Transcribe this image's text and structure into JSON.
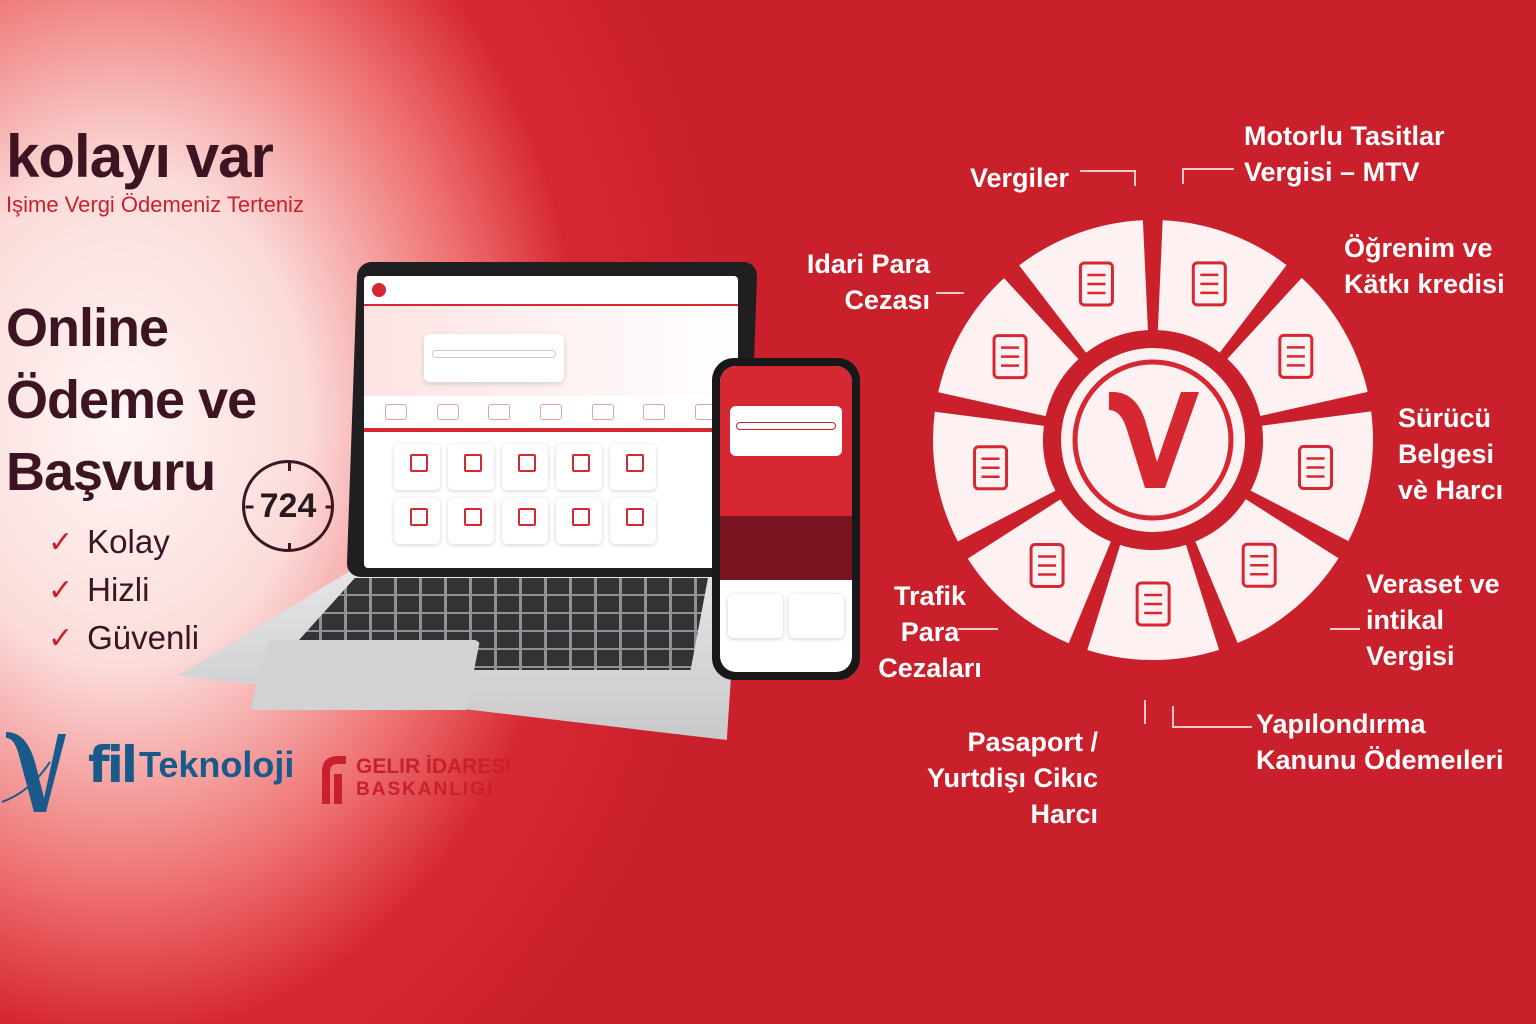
{
  "hero": {
    "brand": "kolayı var",
    "tagline": "Işime Vergi Ödemeniz Terteniz",
    "headline_lines": [
      "Online",
      "Ödeme ve",
      "Başvuru"
    ],
    "badge": "724",
    "checks": [
      "Kolay",
      "Hizli",
      "Güvenli"
    ],
    "check_symbol": "✓"
  },
  "logos": {
    "fil_mark": "fil",
    "fil_text": "Teknoloji",
    "gib_line1": "GELIR İDARESI",
    "gib_line2": "BASKANLIGI"
  },
  "wheel": {
    "center_icon": "v-logo-icon",
    "segments": [
      {
        "label": "Vergiler",
        "icon": "gavel-icon"
      },
      {
        "label": "Motorlu Tasitlar Vergisi – MTV",
        "icon": "graduate-icon"
      },
      {
        "label": "Öğrenim ve Katkı kredisi",
        "icon": "document-icon"
      },
      {
        "label": "Sürücü Belgesi vè Harcı",
        "icon": "form-pen-icon"
      },
      {
        "label": "Veraset ve intikal Vergisi",
        "icon": "document-seal-icon"
      },
      {
        "label": "Yapılondırma Kanunu Ödemeıleri",
        "icon": "star-card-icon"
      },
      {
        "label": "Pasaport / Yurtdişı Cikıc Harcı",
        "icon": "passport-icon"
      },
      {
        "label": "Trafik Para Cezaları",
        "icon": "car-document-icon"
      },
      {
        "label": "Idari Para Cezası",
        "icon": "shirt-document-icon"
      }
    ]
  },
  "labels": {
    "vergiler": "Vergiler",
    "mtv_1": "Motorlu Tasitlar",
    "mtv_2": "Vergisi – MTV",
    "ogrenim_1": "Öğrenim ve",
    "ogrenim_2": "Kätkı kredisi",
    "surucu_1": "Sürücü",
    "surucu_2": "Belgesi",
    "surucu_3": "vè Harcı",
    "veraset_1": "Veraset ve",
    "veraset_2": "intikal",
    "veraset_3": "Vergisi",
    "yapilan_1": "Yapılondırma",
    "yapilan_2": "Kanunu Ödemeıleri",
    "pasaport_1": "Pasaport /",
    "pasaport_2": "Yurtdişı Cikıc",
    "pasaport_3": "Harcı",
    "trafik_1": "Trafik",
    "trafik_2": "Para",
    "trafik_3": "Cezaları",
    "idari_1": "Idari Para",
    "idari_2": "Cezası"
  },
  "colors": {
    "brand_red": "#d62832",
    "dark_text": "#3d1522",
    "logo_blue": "#1a5a8a"
  }
}
